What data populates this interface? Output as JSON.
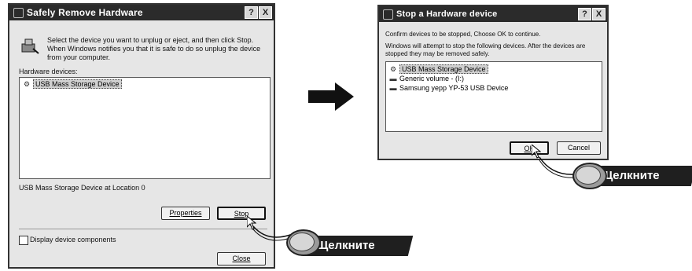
{
  "left_dialog": {
    "title": "Safely Remove Hardware",
    "help_btn": "?",
    "close_btn": "X",
    "instruction": "Select the device you want to unplug or eject, and then click Stop. When Windows notifies you that it is safe to do so unplug the device from your computer.",
    "hardware_label": "Hardware devices:",
    "devices": [
      "USB Mass Storage Device"
    ],
    "device_location": "USB Mass Storage Device at Location 0",
    "properties_button": "Properties",
    "stop_button": "Stop",
    "display_components": "Display device components",
    "close_button": "Close"
  },
  "right_dialog": {
    "title": "Stop a Hardware device",
    "help_btn": "?",
    "close_btn": "X",
    "confirm_text": "Confirm devices to be stopped, Choose OK to continue.",
    "stop_text": "Windows will attempt to stop the following devices. After the devices are stopped they may be removed safely.",
    "devices": [
      "USB Mass Storage Device",
      "Generic volume - (I:)",
      "Samsung yepp YP-53 USB Device"
    ],
    "ok_button": "OK",
    "cancel_button": "Cancel"
  },
  "callouts": {
    "click_label_1": "Щелкните",
    "click_label_2": "Щелкните"
  },
  "colors": {
    "titlebar": "#2b2b2b",
    "window_bg": "#e6e6e6",
    "badge": "#1f1f1f"
  }
}
